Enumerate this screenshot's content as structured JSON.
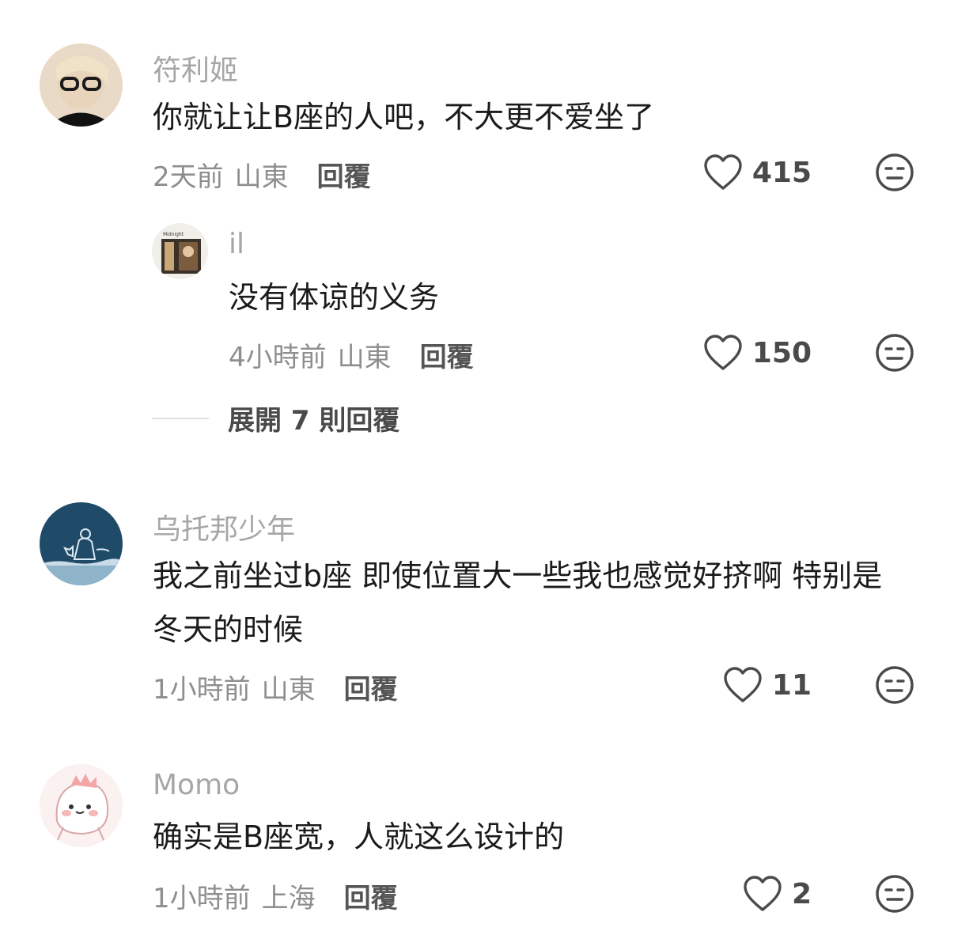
{
  "comments": [
    {
      "username": "符利姬",
      "text": "你就让让B座的人吧，不大更不爱坐了",
      "time": "2天前",
      "location": "山東",
      "reply_label": "回覆",
      "likes": "415"
    },
    {
      "username": "il",
      "text": "没有体谅的义务",
      "time": "4小時前",
      "location": "山東",
      "reply_label": "回覆",
      "likes": "150"
    },
    {
      "username": "乌托邦少年",
      "text": "我之前坐过b座 即使位置大一些我也感觉好挤啊 特别是冬天的时候",
      "time": "1小時前",
      "location": "山東",
      "reply_label": "回覆",
      "likes": "11"
    },
    {
      "username": "Momo",
      "text": "确实是B座宽，人就这么设计的",
      "time": "1小時前",
      "location": "上海",
      "reply_label": "回覆",
      "likes": "2"
    }
  ],
  "expand_replies": "展開 7 則回覆",
  "avatar_thumbnail_text": "Midnight",
  "colors": {
    "username": "#a6a6a6",
    "text": "#1b1b1b",
    "meta": "#8e8e8e",
    "icon": "#4a4a4a"
  }
}
